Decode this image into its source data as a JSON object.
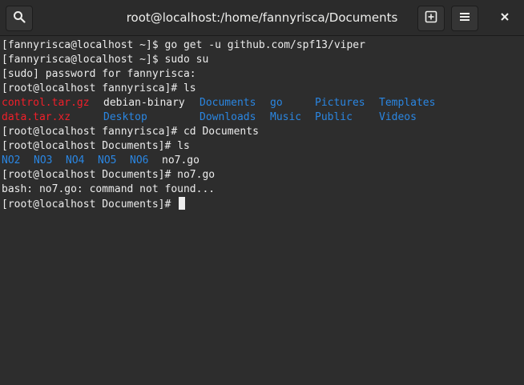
{
  "window": {
    "title": "root@localhost:/home/fannyrisca/Documents"
  },
  "headerbar": {
    "buttons": [
      {
        "icon": "search-icon"
      },
      {
        "icon": "new-tab-icon"
      },
      {
        "icon": "hamburger-menu-icon"
      },
      {
        "icon": "close-icon"
      }
    ]
  },
  "colors": {
    "background": "#2d2d2d",
    "foreground": "#ececec",
    "archive": "#f11f2a",
    "directory": "#2a86e2"
  },
  "terminal": {
    "lines": [
      "[fannyrisca@localhost ~]$ go get -u github.com/spf13/viper",
      "[fannyrisca@localhost ~]$ sudo su",
      "[sudo] password for fannyrisca:",
      "[root@localhost fannyrisca]# ls"
    ],
    "ls_home": {
      "row1": [
        "control.tar.gz",
        "debian-binary",
        "Documents",
        "go",
        "Pictures",
        "Templates"
      ],
      "row2": [
        "data.tar.xz",
        "Desktop",
        "Downloads",
        "Music",
        "Public",
        "Videos"
      ]
    },
    "line_cd": "[root@localhost fannyrisca]# cd Documents",
    "line_ls2": "[root@localhost Documents]# ls",
    "ls_documents": [
      "NO2",
      "NO3",
      "NO4",
      "NO5",
      "NO6",
      "no7.go"
    ],
    "line_run": "[root@localhost Documents]# no7.go",
    "line_error": "bash: no7.go: command not found...",
    "prompt": "[root@localhost Documents]# "
  }
}
